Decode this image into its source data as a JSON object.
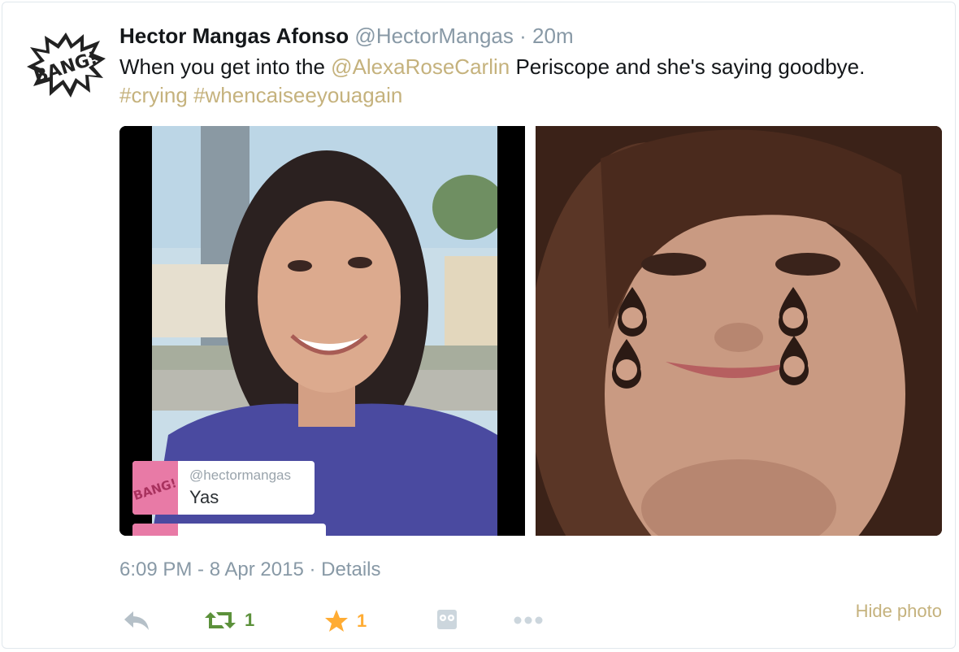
{
  "tweet": {
    "fullname": "Hector Mangas Afonso",
    "handle": "@HectorMangas",
    "separator": "·",
    "time": "20m",
    "text_before": "When you get into the ",
    "mention": "@AlexaRoseCarlin",
    "text_after": " Periscope and she's saying goodbye.",
    "hashtag1": "#crying",
    "hashtag2": "#whencaiseeyouagain",
    "avatar_text": "BANG!"
  },
  "media": {
    "left": {
      "comment_user": "@hectormangas",
      "comment_text": "Yas",
      "comment_thumb_text": "BANG!"
    }
  },
  "meta": {
    "timestamp": "6:09 PM - 8 Apr 2015",
    "separator": "·",
    "details": "Details"
  },
  "actions": {
    "retweet_count": "1",
    "favorite_count": "1",
    "hide_photo": "Hide photo",
    "icons": [
      "reply-icon",
      "retweet-icon",
      "star-icon",
      "owl-icon",
      "more-icon"
    ]
  },
  "colors": {
    "link": "#c5b27d",
    "retweet": "#5c913b",
    "favorite": "#ffac33",
    "muted": "#8899a6"
  }
}
